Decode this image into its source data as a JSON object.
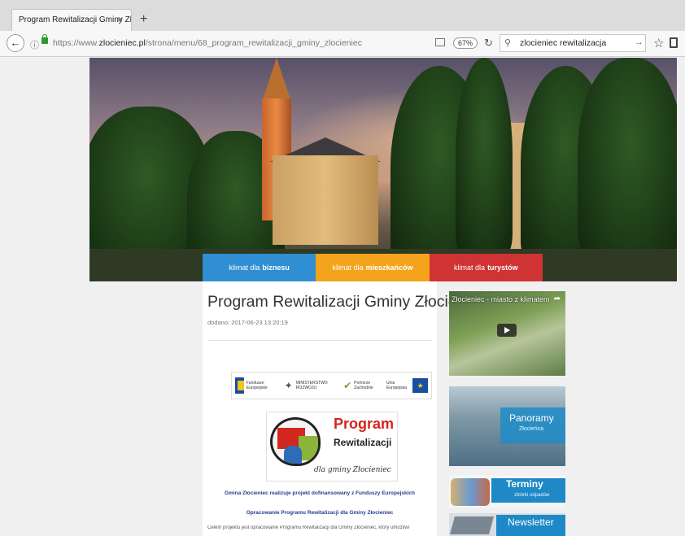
{
  "browser": {
    "tab_title": "Program Rewitalizacji Gminy Zło",
    "tab_close": "×",
    "new_tab": "+",
    "url_prefix": "https://www.",
    "url_domain": "zlocieniec.pl",
    "url_path": "/strona/menu/68_program_rewitalizacji_gminy_zlocieniec",
    "zoom": "67%",
    "search_value": "zlocieniec rewitalizacja"
  },
  "nav": {
    "business_prefix": "klimat dla",
    "business_bold": "biznesu",
    "residents_prefix": "klimat dla",
    "residents_bold": "mieszkańców",
    "tourists_prefix": "klimat dla",
    "tourists_bold": "turystów",
    "colors": {
      "business": "#2f8fd2",
      "residents": "#f3a31c",
      "tourists": "#d03333"
    }
  },
  "article": {
    "title": "Program Rewitalizacji Gminy Złocieniec",
    "date": "dodano: 2017-06-23 13:20:19",
    "funding_logos": {
      "fe_label": "Fundusze Europejskie",
      "ministry_label": "MINISTERSTWO ROZWOJU",
      "pomorze_label": "Pomorze Zachodnie",
      "ue_label": "Unia Europejska"
    },
    "logo": {
      "program": "Program",
      "rewitalizacji": "Rewitalizacji",
      "sub": "dla gminy Złocieniec"
    },
    "line1": "Gmina Złocieniec realizuje projekt dofinansowany z Funduszy Europejskich",
    "line2": "Opracowanie Programu Rewitalizacji dla Gminy Złocieniec",
    "body": "Celem projektu jest opracowanie Programu Rewitalizacji dla Gminy Złocieniec, który umożliwi"
  },
  "sidebar": {
    "video_title": "Złocieniec - miasto z klimatem",
    "panorama_title": "Panoramy",
    "panorama_sub": "Złocieńca",
    "terminy_title": "Terminy",
    "terminy_sub": "zbiórki odpadów",
    "newsletter_title": "Newsletter"
  }
}
